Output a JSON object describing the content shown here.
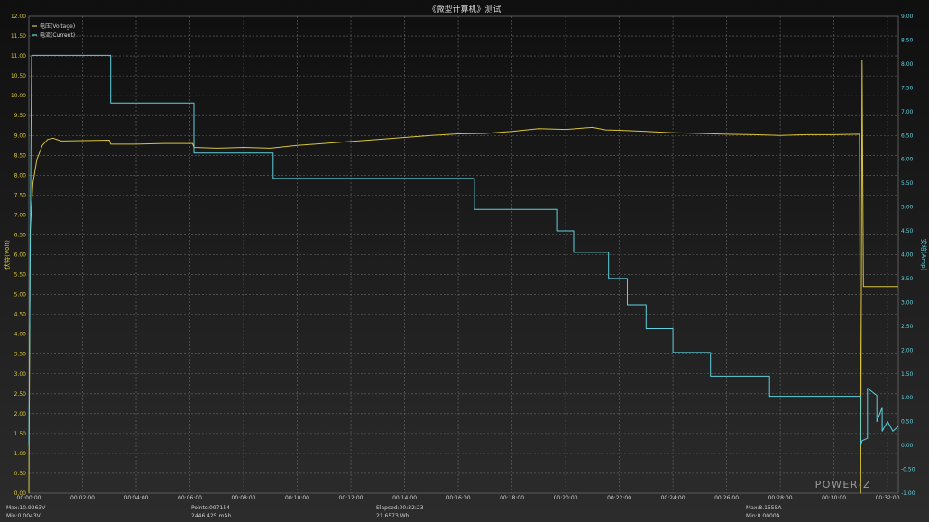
{
  "chart_data": {
    "type": "line",
    "title": "《微型计算机》测试",
    "ylabel_left": "伏特(Volt)",
    "ylabel_right": "安培(Amp)",
    "x_ticks": [
      "00:00:00",
      "00:02:00",
      "00:04:00",
      "00:06:00",
      "00:08:00",
      "00:10:00",
      "00:12:00",
      "00:14:00",
      "00:16:00",
      "00:18:00",
      "00:20:00",
      "00:22:00",
      "00:24:00",
      "00:26:00",
      "00:28:00",
      "00:30:00",
      "00:32:00"
    ],
    "xlim_minutes": [
      0,
      32.4
    ],
    "ylim_left": [
      0,
      12
    ],
    "ylim_right": [
      -1,
      9
    ],
    "grid": true,
    "legend_position": "top-left",
    "series": [
      {
        "name": "电压(Voltage)",
        "axis": "left",
        "color": "#d8c43c",
        "points": [
          [
            0,
            0
          ],
          [
            0.05,
            6.6
          ],
          [
            0.15,
            7.8
          ],
          [
            0.3,
            8.4
          ],
          [
            0.5,
            8.75
          ],
          [
            0.7,
            8.9
          ],
          [
            0.9,
            8.93
          ],
          [
            1.2,
            8.86
          ],
          [
            2,
            8.87
          ],
          [
            3,
            8.88
          ],
          [
            3.05,
            8.78
          ],
          [
            4,
            8.78
          ],
          [
            5,
            8.8
          ],
          [
            6.1,
            8.8
          ],
          [
            6.15,
            8.7
          ],
          [
            7,
            8.68
          ],
          [
            8,
            8.7
          ],
          [
            9,
            8.68
          ],
          [
            10,
            8.75
          ],
          [
            11,
            8.8
          ],
          [
            12,
            8.85
          ],
          [
            13,
            8.9
          ],
          [
            14,
            8.95
          ],
          [
            15,
            9.0
          ],
          [
            16,
            9.04
          ],
          [
            17,
            9.05
          ],
          [
            18,
            9.1
          ],
          [
            19,
            9.17
          ],
          [
            20,
            9.15
          ],
          [
            21,
            9.2
          ],
          [
            21.5,
            9.14
          ],
          [
            22,
            9.13
          ],
          [
            23,
            9.1
          ],
          [
            24,
            9.07
          ],
          [
            25,
            9.05
          ],
          [
            26,
            9.03
          ],
          [
            27,
            9.02
          ],
          [
            28,
            9.0
          ],
          [
            29,
            9.02
          ],
          [
            30,
            9.02
          ],
          [
            30.95,
            9.03
          ],
          [
            31.0,
            0.0
          ],
          [
            31.05,
            10.9
          ],
          [
            31.1,
            5.2
          ],
          [
            32.4,
            5.2
          ]
        ]
      },
      {
        "name": "电流(Current)",
        "axis": "right",
        "color": "#5fd0dc",
        "points": [
          [
            0,
            0
          ],
          [
            0.1,
            8.18
          ],
          [
            3.05,
            8.18
          ],
          [
            3.05,
            7.18
          ],
          [
            6.15,
            7.18
          ],
          [
            6.15,
            6.13
          ],
          [
            9.1,
            6.13
          ],
          [
            9.1,
            5.6
          ],
          [
            16.6,
            5.6
          ],
          [
            16.6,
            4.95
          ],
          [
            19.7,
            4.95
          ],
          [
            19.7,
            4.5
          ],
          [
            20.3,
            4.5
          ],
          [
            20.3,
            4.05
          ],
          [
            21.6,
            4.05
          ],
          [
            21.6,
            3.5
          ],
          [
            22.3,
            3.5
          ],
          [
            22.3,
            2.95
          ],
          [
            23,
            2.95
          ],
          [
            23,
            2.45
          ],
          [
            24,
            2.45
          ],
          [
            24,
            1.95
          ],
          [
            25.4,
            1.95
          ],
          [
            25.4,
            1.45
          ],
          [
            27.6,
            1.45
          ],
          [
            27.6,
            1.03
          ],
          [
            31.0,
            1.03
          ],
          [
            31.0,
            0.0
          ],
          [
            31.05,
            0.1
          ],
          [
            31.25,
            0.15
          ],
          [
            31.25,
            1.2
          ],
          [
            31.6,
            1.05
          ],
          [
            31.6,
            0.5
          ],
          [
            31.8,
            0.8
          ],
          [
            31.8,
            0.3
          ],
          [
            32.0,
            0.5
          ],
          [
            32.2,
            0.3
          ],
          [
            32.4,
            0.4
          ]
        ]
      }
    ],
    "footer": {
      "max_voltage": "Max:10.9263V",
      "min_voltage": "Min:0.0043V",
      "points": "Points:097154",
      "capacity": "2446.425 mAh",
      "elapsed": "Elapsed:00:32:23",
      "energy": "21.6573 Wh",
      "max_current": "Max:8.1555A",
      "min_current": "Min:0.0000A"
    },
    "brand": "POWER-Z"
  }
}
